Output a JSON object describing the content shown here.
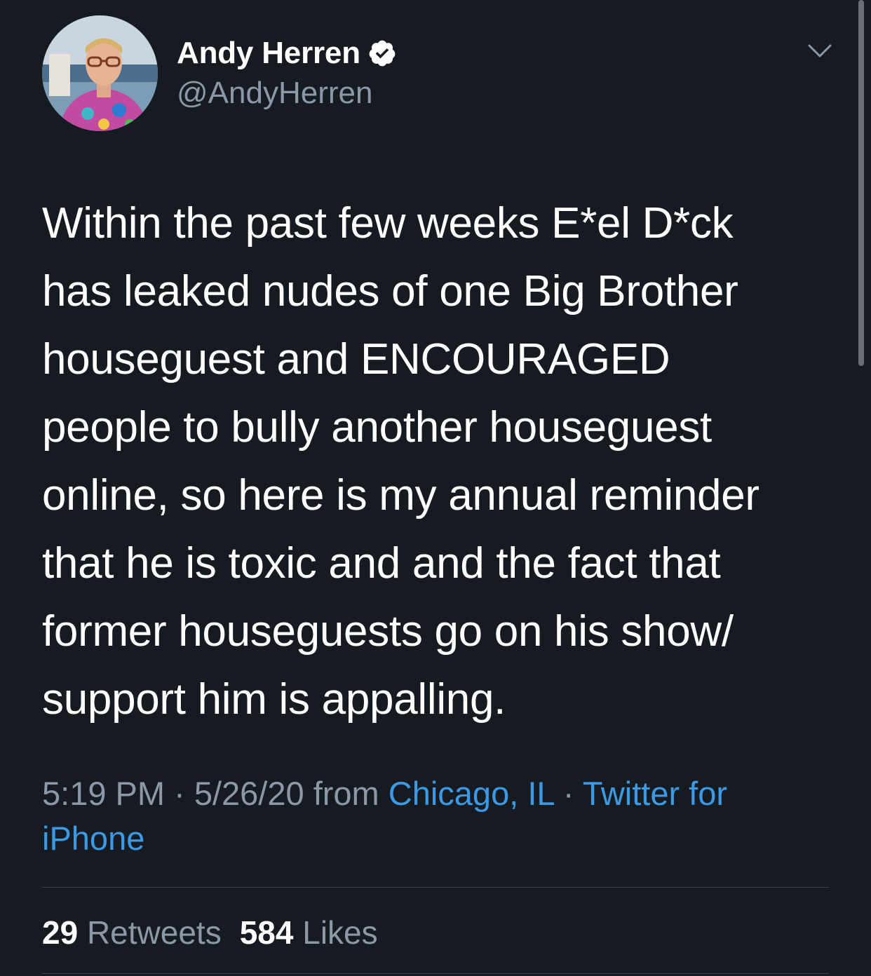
{
  "author": {
    "display_name": "Andy Herren",
    "handle": "@AndyHerren",
    "verified_icon": "verified-check-icon"
  },
  "tweet": {
    "lines": [
      "Within the past few weeks E*el D*ck",
      "has leaked nudes of one Big Brother",
      "houseguest and ENCOURAGED",
      "people to bully another houseguest",
      "online, so here is my annual reminder",
      "that he is toxic and and the fact that",
      "former houseguests go on his show/",
      "support him is appalling."
    ]
  },
  "meta": {
    "time": "5:19 PM",
    "separator": " · ",
    "date": "5/26/20",
    "from_label": " from ",
    "location": "Chicago, IL",
    "client": "Twitter for iPhone"
  },
  "stats": {
    "retweets_count": "29",
    "retweets_label": "Retweets",
    "likes_count": "584",
    "likes_label": "Likes"
  },
  "colors": {
    "background": "#161b22",
    "text_primary": "#ffffff",
    "text_secondary": "#8b98a5",
    "link": "#3b9ae6",
    "divider": "#38444d"
  },
  "icons": {
    "menu": "chevron-down-icon",
    "avatar": "avatar"
  }
}
